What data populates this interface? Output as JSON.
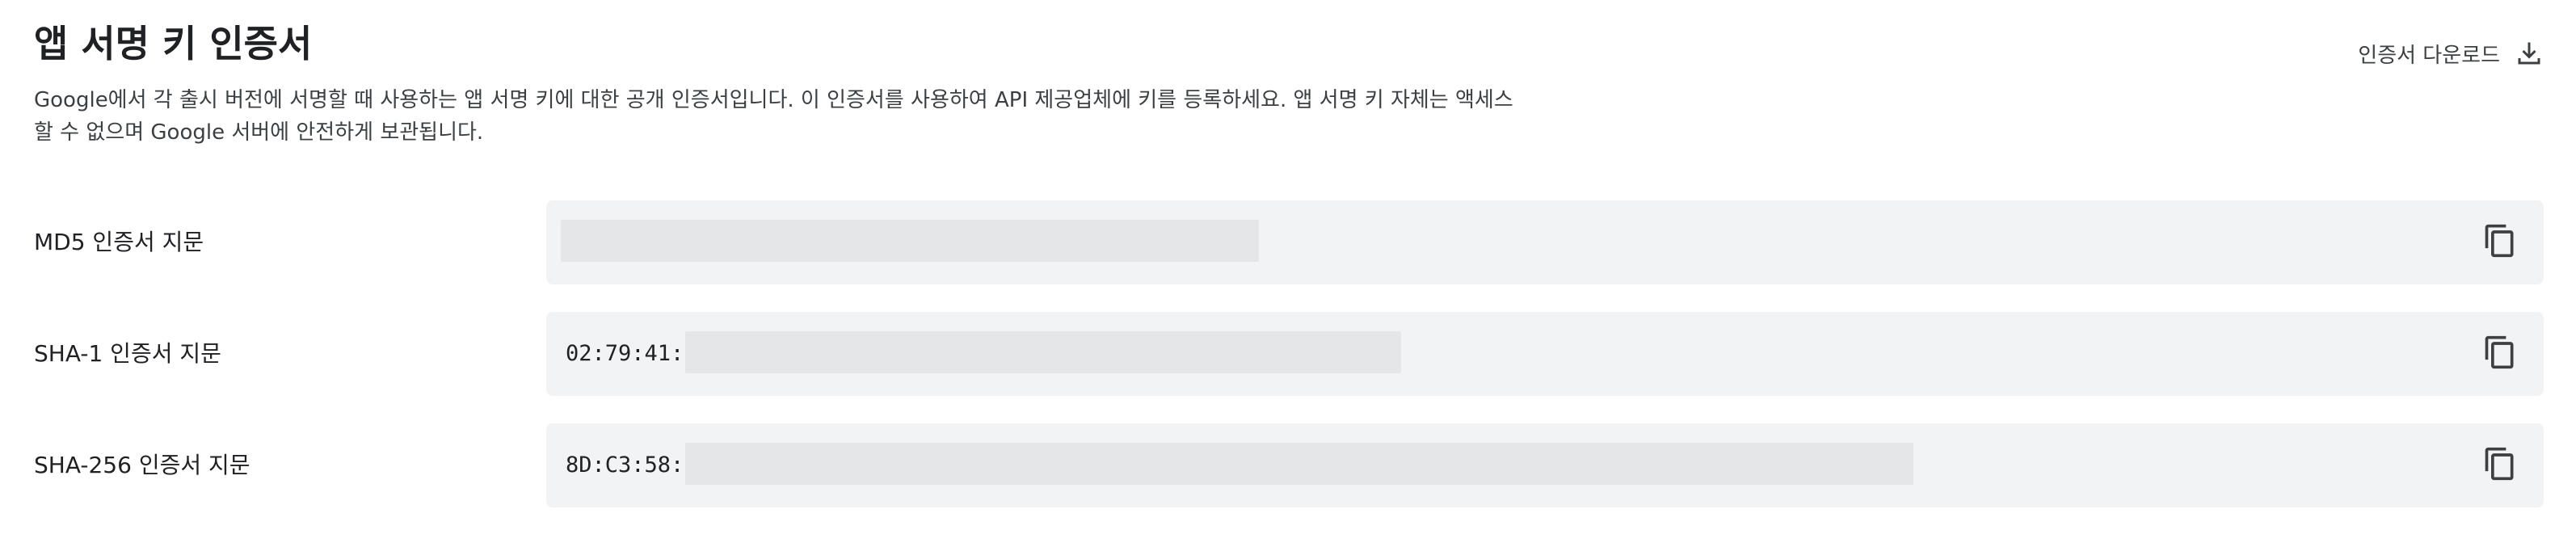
{
  "header": {
    "title": "앱 서명 키 인증서",
    "download_label": "인증서 다운로드",
    "download_icon": "download-icon"
  },
  "description": "Google에서 각 출시 버전에 서명할 때 사용하는 앱 서명 키에 대한 공개 인증서입니다. 이 인증서를 사용하여 API 제공업체에 키를 등록하세요. 앱 서명 키 자체는 액세스할 수 없으며 Google 서버에 안전하게 보관됩니다.",
  "fingerprints": [
    {
      "label": "MD5 인증서 지문",
      "value_prefix": "",
      "redacted": true,
      "copy_icon": "copy-icon"
    },
    {
      "label": "SHA-1 인증서 지문",
      "value_prefix": "02:79:41:",
      "redacted": true,
      "copy_icon": "copy-icon"
    },
    {
      "label": "SHA-256 인증서 지문",
      "value_prefix": "8D:C3:58:",
      "redacted": true,
      "copy_icon": "copy-icon"
    }
  ],
  "colors": {
    "text_primary": "#202124",
    "text_secondary": "#3c4043",
    "value_background": "#f1f3f4",
    "redaction": "#e5e6e7"
  }
}
